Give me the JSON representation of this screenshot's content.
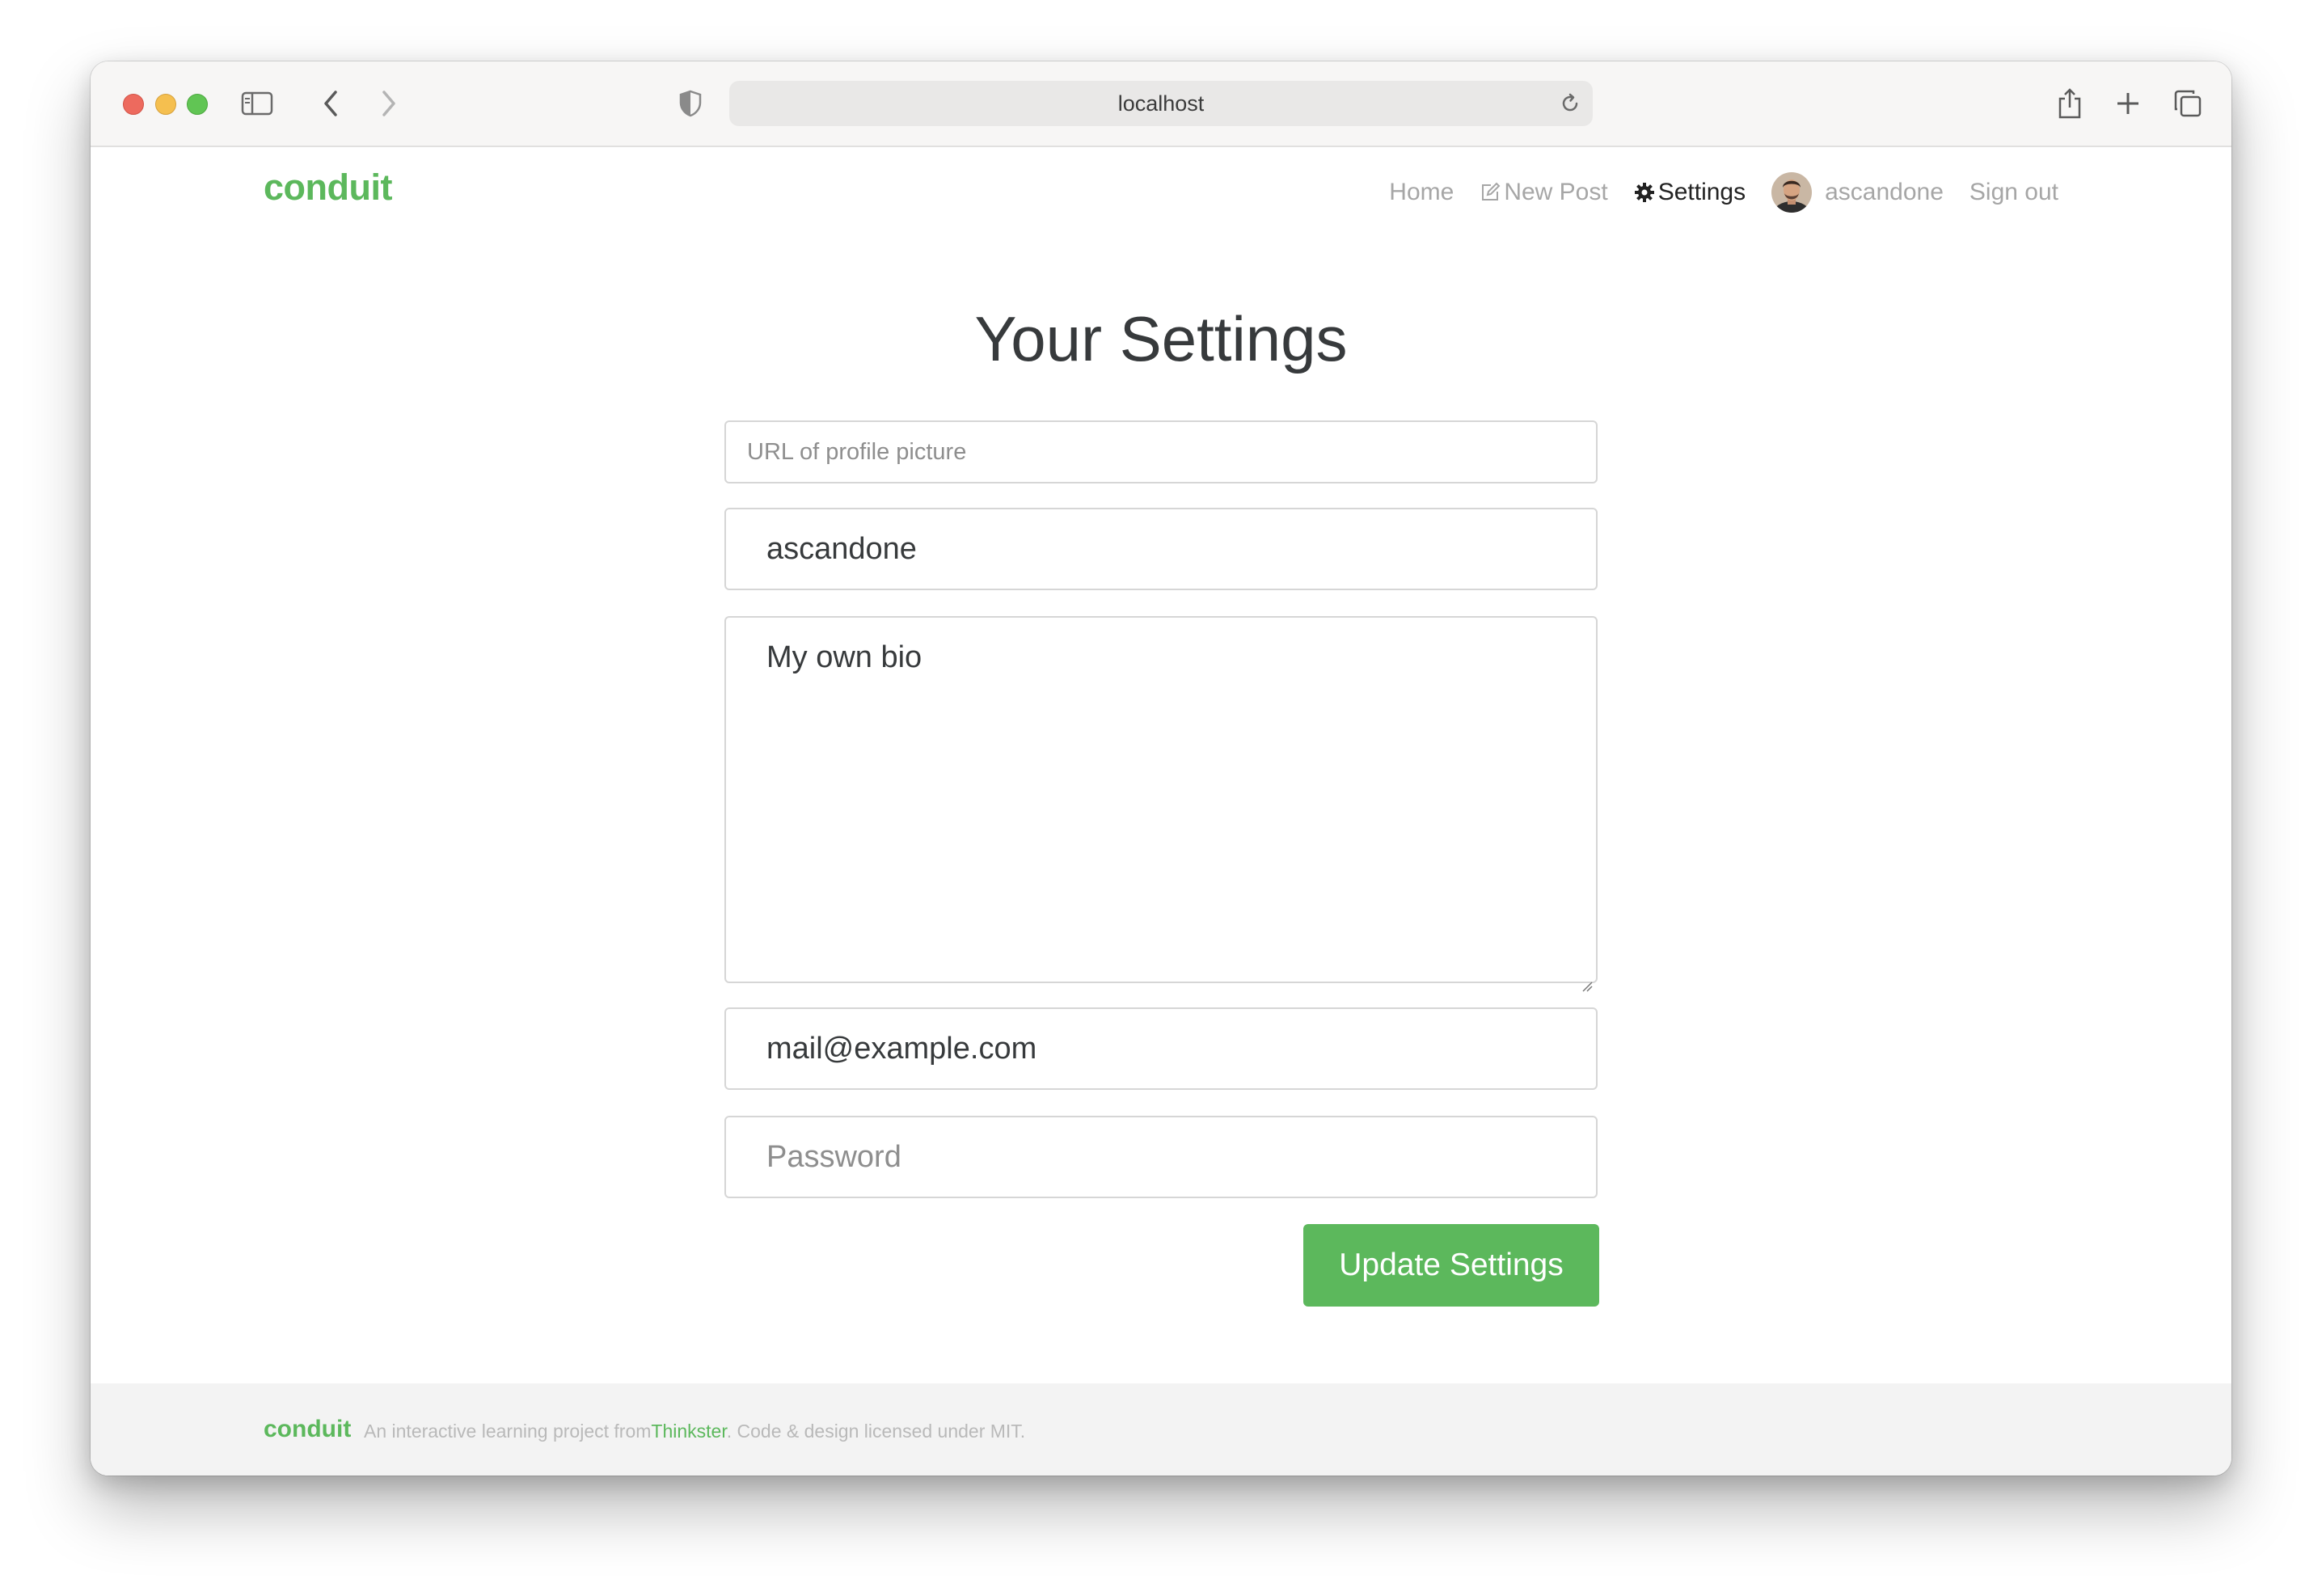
{
  "browser": {
    "url": "localhost",
    "toolbar_icons": [
      "sidebar-icon",
      "back-icon",
      "forward-icon",
      "shield-icon",
      "reload-icon",
      "share-icon",
      "new-tab-icon",
      "tabs-overview-icon"
    ]
  },
  "navbar": {
    "brand": "conduit",
    "links": [
      {
        "label": "Home",
        "icon": null,
        "active": false
      },
      {
        "label": "New Post",
        "icon": "edit-icon",
        "active": false
      },
      {
        "label": "Settings",
        "icon": "gear-icon",
        "active": true
      },
      {
        "label": "ascandone",
        "icon": "avatar",
        "active": false
      },
      {
        "label": "Sign out",
        "icon": null,
        "active": false
      }
    ]
  },
  "settings": {
    "title": "Your Settings",
    "image_placeholder": "URL of profile picture",
    "username_value": "ascandone",
    "bio_value": "My own bio",
    "email_value": "mail@example.com",
    "password_placeholder": "Password",
    "submit_label": "Update Settings"
  },
  "footer": {
    "brand": "conduit",
    "text_before": "An interactive learning project from",
    "link": "Thinkster",
    "text_after": ". Code & design licensed under MIT."
  },
  "colors": {
    "brand": "#5cb85c",
    "text": "#373a3c",
    "muted": "#a6a6a6"
  }
}
